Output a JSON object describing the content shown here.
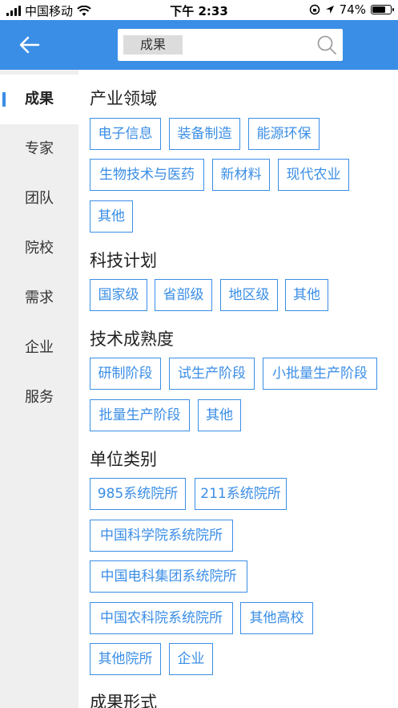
{
  "status_bar": {
    "carrier": "中国移动",
    "time": "下午 2:33",
    "battery": "74%",
    "battery_level": 0.74
  },
  "header": {
    "search_tag": "成果",
    "icons": {
      "back": "arrow-left-icon",
      "search": "search-icon"
    }
  },
  "sidebar": {
    "items": [
      {
        "label": "成果",
        "active": true
      },
      {
        "label": "专家",
        "active": false
      },
      {
        "label": "团队",
        "active": false
      },
      {
        "label": "院校",
        "active": false
      },
      {
        "label": "需求",
        "active": false
      },
      {
        "label": "企业",
        "active": false
      },
      {
        "label": "服务",
        "active": false
      }
    ]
  },
  "sections": [
    {
      "title": "产业领域",
      "tags": [
        "电子信息",
        "装备制造",
        "能源环保",
        "生物技术与医药",
        "新材料",
        "现代农业",
        "其他"
      ]
    },
    {
      "title": "科技计划",
      "tags": [
        "国家级",
        "省部级",
        "地区级",
        "其他"
      ]
    },
    {
      "title": "技术成熟度",
      "tags": [
        "研制阶段",
        "试生产阶段",
        "小批量生产阶段",
        "批量生产阶段",
        "其他"
      ]
    },
    {
      "title": "单位类别",
      "tags": [
        "985系统院所",
        "211系统院所",
        "中国科学院系统院所",
        "中国电科集团系统院所",
        "中国农科院系统院所",
        "其他高校",
        "其他院所",
        "企业"
      ]
    },
    {
      "title": "成果形式",
      "tags": []
    }
  ],
  "colors": {
    "accent": "#3a8ee6",
    "sidebar_bg": "#efefef"
  }
}
